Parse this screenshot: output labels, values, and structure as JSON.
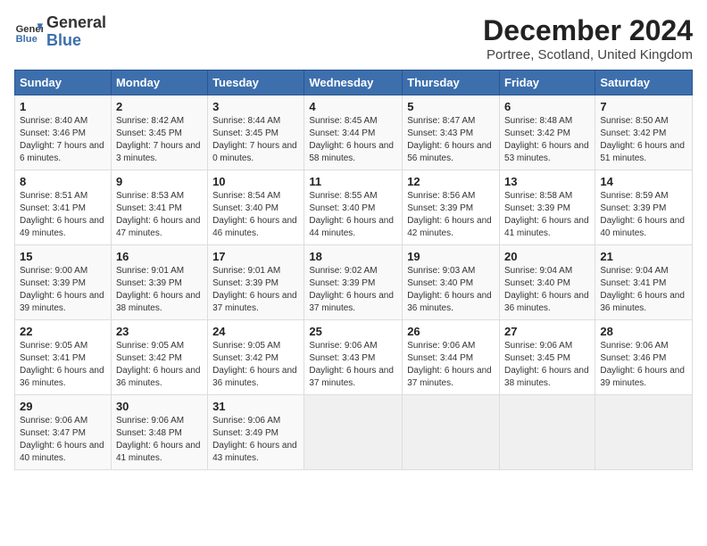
{
  "header": {
    "logo_line1": "General",
    "logo_line2": "Blue",
    "title": "December 2024",
    "subtitle": "Portree, Scotland, United Kingdom"
  },
  "columns": [
    "Sunday",
    "Monday",
    "Tuesday",
    "Wednesday",
    "Thursday",
    "Friday",
    "Saturday"
  ],
  "weeks": [
    [
      {
        "day": "1",
        "info": "Sunrise: 8:40 AM\nSunset: 3:46 PM\nDaylight: 7 hours and 6 minutes."
      },
      {
        "day": "2",
        "info": "Sunrise: 8:42 AM\nSunset: 3:45 PM\nDaylight: 7 hours and 3 minutes."
      },
      {
        "day": "3",
        "info": "Sunrise: 8:44 AM\nSunset: 3:45 PM\nDaylight: 7 hours and 0 minutes."
      },
      {
        "day": "4",
        "info": "Sunrise: 8:45 AM\nSunset: 3:44 PM\nDaylight: 6 hours and 58 minutes."
      },
      {
        "day": "5",
        "info": "Sunrise: 8:47 AM\nSunset: 3:43 PM\nDaylight: 6 hours and 56 minutes."
      },
      {
        "day": "6",
        "info": "Sunrise: 8:48 AM\nSunset: 3:42 PM\nDaylight: 6 hours and 53 minutes."
      },
      {
        "day": "7",
        "info": "Sunrise: 8:50 AM\nSunset: 3:42 PM\nDaylight: 6 hours and 51 minutes."
      }
    ],
    [
      {
        "day": "8",
        "info": "Sunrise: 8:51 AM\nSunset: 3:41 PM\nDaylight: 6 hours and 49 minutes."
      },
      {
        "day": "9",
        "info": "Sunrise: 8:53 AM\nSunset: 3:41 PM\nDaylight: 6 hours and 47 minutes."
      },
      {
        "day": "10",
        "info": "Sunrise: 8:54 AM\nSunset: 3:40 PM\nDaylight: 6 hours and 46 minutes."
      },
      {
        "day": "11",
        "info": "Sunrise: 8:55 AM\nSunset: 3:40 PM\nDaylight: 6 hours and 44 minutes."
      },
      {
        "day": "12",
        "info": "Sunrise: 8:56 AM\nSunset: 3:39 PM\nDaylight: 6 hours and 42 minutes."
      },
      {
        "day": "13",
        "info": "Sunrise: 8:58 AM\nSunset: 3:39 PM\nDaylight: 6 hours and 41 minutes."
      },
      {
        "day": "14",
        "info": "Sunrise: 8:59 AM\nSunset: 3:39 PM\nDaylight: 6 hours and 40 minutes."
      }
    ],
    [
      {
        "day": "15",
        "info": "Sunrise: 9:00 AM\nSunset: 3:39 PM\nDaylight: 6 hours and 39 minutes."
      },
      {
        "day": "16",
        "info": "Sunrise: 9:01 AM\nSunset: 3:39 PM\nDaylight: 6 hours and 38 minutes."
      },
      {
        "day": "17",
        "info": "Sunrise: 9:01 AM\nSunset: 3:39 PM\nDaylight: 6 hours and 37 minutes."
      },
      {
        "day": "18",
        "info": "Sunrise: 9:02 AM\nSunset: 3:39 PM\nDaylight: 6 hours and 37 minutes."
      },
      {
        "day": "19",
        "info": "Sunrise: 9:03 AM\nSunset: 3:40 PM\nDaylight: 6 hours and 36 minutes."
      },
      {
        "day": "20",
        "info": "Sunrise: 9:04 AM\nSunset: 3:40 PM\nDaylight: 6 hours and 36 minutes."
      },
      {
        "day": "21",
        "info": "Sunrise: 9:04 AM\nSunset: 3:41 PM\nDaylight: 6 hours and 36 minutes."
      }
    ],
    [
      {
        "day": "22",
        "info": "Sunrise: 9:05 AM\nSunset: 3:41 PM\nDaylight: 6 hours and 36 minutes."
      },
      {
        "day": "23",
        "info": "Sunrise: 9:05 AM\nSunset: 3:42 PM\nDaylight: 6 hours and 36 minutes."
      },
      {
        "day": "24",
        "info": "Sunrise: 9:05 AM\nSunset: 3:42 PM\nDaylight: 6 hours and 36 minutes."
      },
      {
        "day": "25",
        "info": "Sunrise: 9:06 AM\nSunset: 3:43 PM\nDaylight: 6 hours and 37 minutes."
      },
      {
        "day": "26",
        "info": "Sunrise: 9:06 AM\nSunset: 3:44 PM\nDaylight: 6 hours and 37 minutes."
      },
      {
        "day": "27",
        "info": "Sunrise: 9:06 AM\nSunset: 3:45 PM\nDaylight: 6 hours and 38 minutes."
      },
      {
        "day": "28",
        "info": "Sunrise: 9:06 AM\nSunset: 3:46 PM\nDaylight: 6 hours and 39 minutes."
      }
    ],
    [
      {
        "day": "29",
        "info": "Sunrise: 9:06 AM\nSunset: 3:47 PM\nDaylight: 6 hours and 40 minutes."
      },
      {
        "day": "30",
        "info": "Sunrise: 9:06 AM\nSunset: 3:48 PM\nDaylight: 6 hours and 41 minutes."
      },
      {
        "day": "31",
        "info": "Sunrise: 9:06 AM\nSunset: 3:49 PM\nDaylight: 6 hours and 43 minutes."
      },
      null,
      null,
      null,
      null
    ]
  ]
}
